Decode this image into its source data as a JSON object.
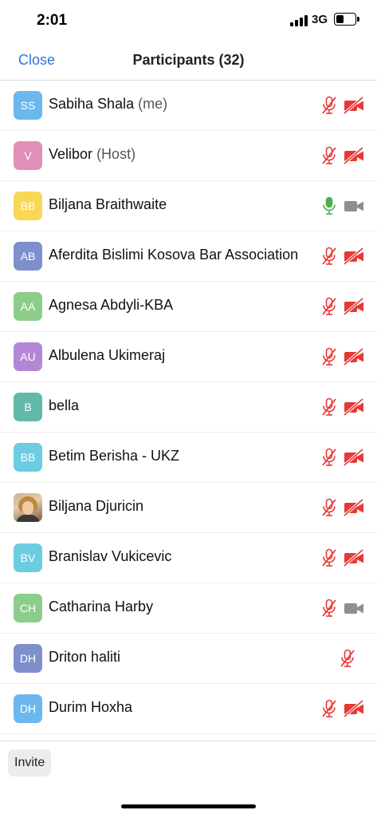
{
  "status": {
    "time": "2:01",
    "network": "3G"
  },
  "nav": {
    "close_label": "Close",
    "title": "Participants (32)"
  },
  "participants": [
    {
      "initials": "SS",
      "name": "Sabiha Shala",
      "suffix": "(me)",
      "color": "#6cb8ee",
      "mic": "muted",
      "video": "off"
    },
    {
      "initials": "V",
      "name": "Velibor",
      "suffix": "(Host)",
      "color": "#e08fb8",
      "mic": "muted",
      "video": "off"
    },
    {
      "initials": "BB",
      "name": "Biljana Braithwaite",
      "suffix": "",
      "color": "#f8d754",
      "mic": "on",
      "video": "on"
    },
    {
      "initials": "AB",
      "name": "Aferdita Bislimi Kosova Bar Association",
      "suffix": "",
      "color": "#7e8fcc",
      "mic": "muted",
      "video": "off"
    },
    {
      "initials": "AA",
      "name": "Agnesa Abdyli-KBA",
      "suffix": "",
      "color": "#8ccd8a",
      "mic": "muted",
      "video": "off"
    },
    {
      "initials": "AU",
      "name": "Albulena Ukimeraj",
      "suffix": "",
      "color": "#b487d6",
      "mic": "muted",
      "video": "off"
    },
    {
      "initials": "B",
      "name": "bella",
      "suffix": "",
      "color": "#62b8a9",
      "mic": "muted",
      "video": "off"
    },
    {
      "initials": "BB",
      "name": "Betim Berisha - UKZ",
      "suffix": "",
      "color": "#6ccce0",
      "mic": "muted",
      "video": "off"
    },
    {
      "initials": "",
      "name": "Biljana Djuricin",
      "suffix": "",
      "color": "",
      "photo": true,
      "mic": "muted",
      "video": "off"
    },
    {
      "initials": "BV",
      "name": "Branislav Vukicevic",
      "suffix": "",
      "color": "#6ccce0",
      "mic": "muted",
      "video": "off"
    },
    {
      "initials": "CH",
      "name": "Catharina Harby",
      "suffix": "",
      "color": "#8ccd8a",
      "mic": "muted",
      "video": "on"
    },
    {
      "initials": "DH",
      "name": "Driton haliti",
      "suffix": "",
      "color": "#7e8fcc",
      "mic": "muted",
      "video": "none"
    },
    {
      "initials": "DH",
      "name": "Durim Hoxha",
      "suffix": "",
      "color": "#6cb8ee",
      "mic": "muted",
      "video": "off"
    }
  ],
  "footer": {
    "invite_label": "Invite"
  },
  "colors": {
    "accent": "#2f72d8",
    "muted_red": "#e53935",
    "active_green": "#4caf50",
    "neutral_gray": "#8e8e93"
  }
}
